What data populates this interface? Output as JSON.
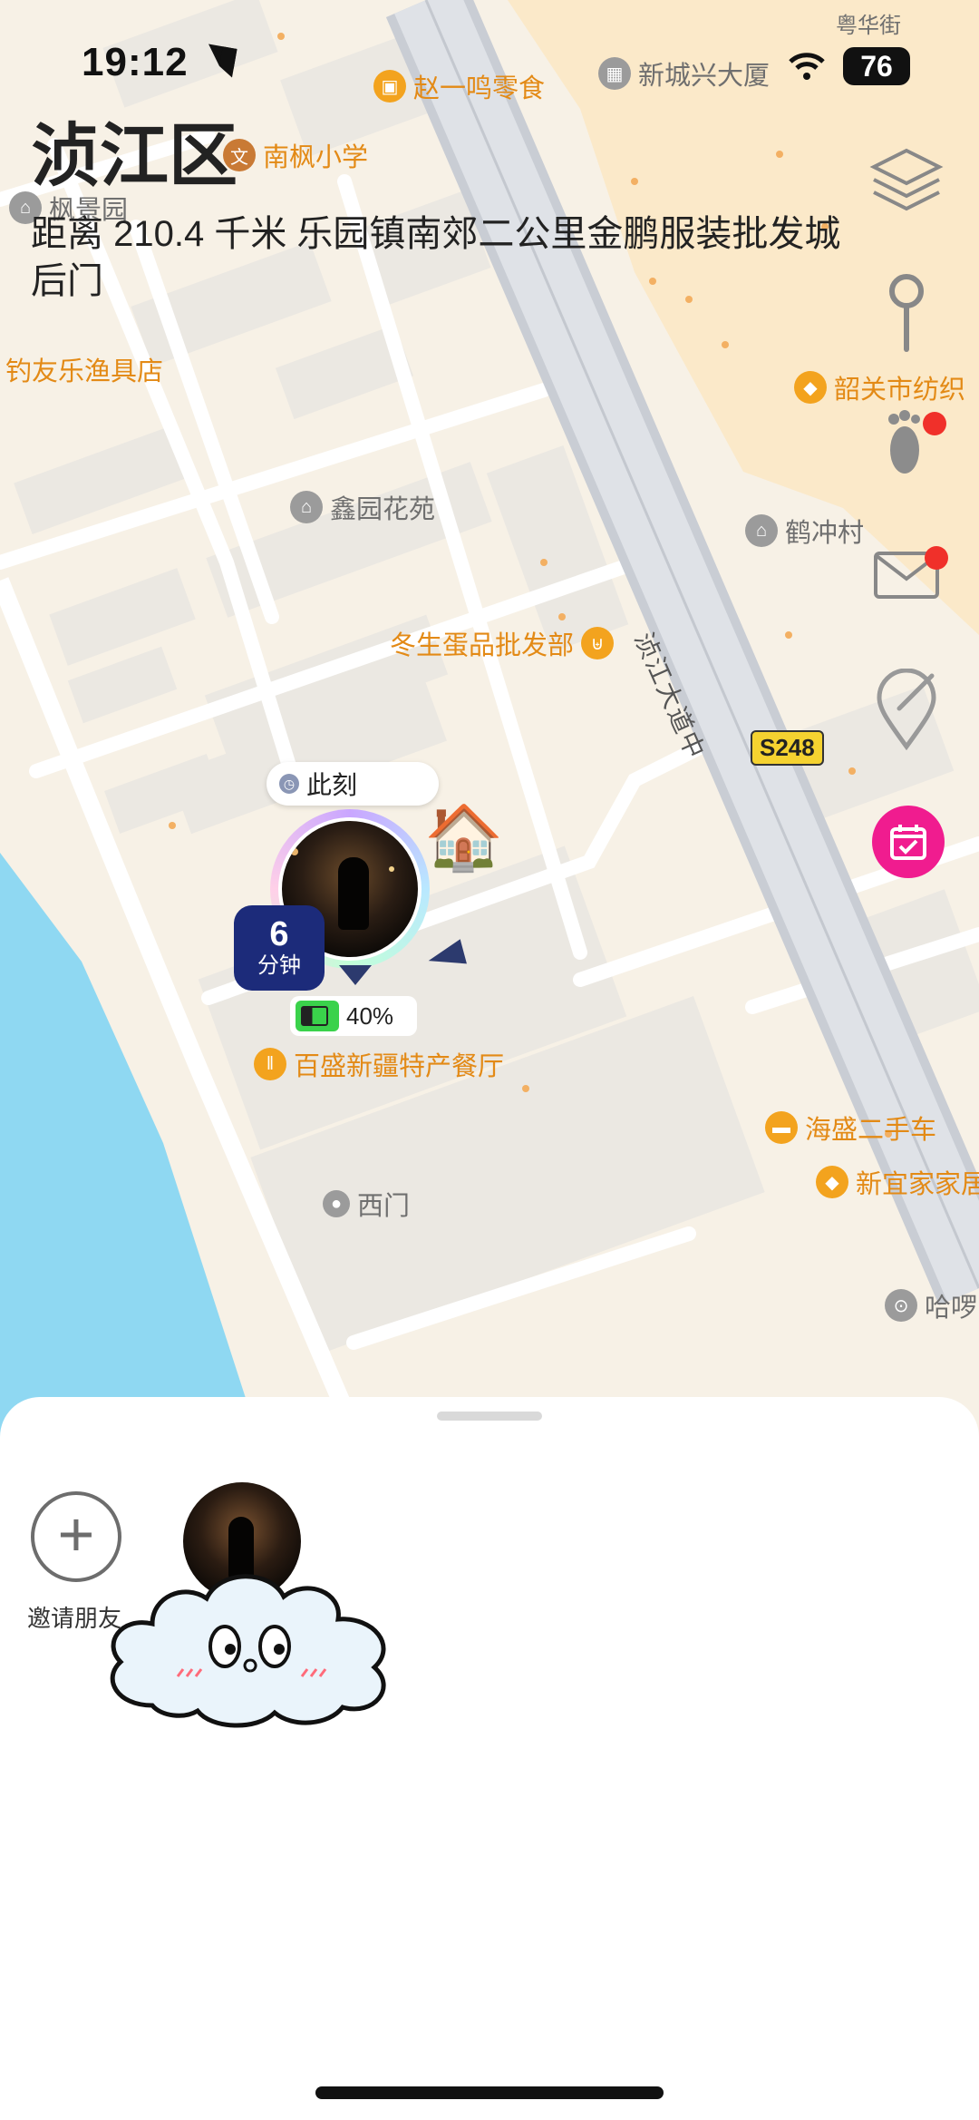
{
  "status_bar": {
    "time": "19:12",
    "battery": "76"
  },
  "header": {
    "district": "浈江区",
    "distance_text": "距离 210.4 千米 乐园镇南郊二公里金鹏服装批发城后门"
  },
  "map": {
    "road_label": "浈江大道中",
    "route_badge": "S248",
    "pois": {
      "zhaoyiming": "赵一鸣零食",
      "xinchengxing": "新城兴大厦",
      "yuehua": "粤华街",
      "nanfeng": "南枫小学",
      "fengjing": "枫景园",
      "diaoyou": "钓友乐渔具店",
      "shaoguan": "韶关市纺织",
      "xinyuan": "鑫园花苑",
      "hechong": "鹤冲村",
      "dongsheng": "冬生蛋品批发部",
      "baisheng": "百盛新疆特产餐厅",
      "haisheng": "海盛二手车",
      "xinyi": "新宜家家居",
      "ximen": "西门",
      "haluo": "哈啰"
    }
  },
  "friend_marker": {
    "time_label": "此刻",
    "eta_value": "6",
    "eta_unit": "分钟",
    "battery_percent": "40%",
    "home_emoji": "🏠"
  },
  "sheet": {
    "invite_label": "邀请朋友"
  },
  "colors": {
    "poi_orange": "#e38a16",
    "marker_navy": "#1c2b7a",
    "water": "#8fd8f2",
    "calendar_pink": "#f01c8f"
  },
  "icons": [
    "layers-icon",
    "pin-icon",
    "footprint-icon",
    "mail-icon",
    "tag-location-icon",
    "calendar-check-icon",
    "plus-icon",
    "location-arrow-icon",
    "wifi-icon",
    "clock-icon"
  ]
}
